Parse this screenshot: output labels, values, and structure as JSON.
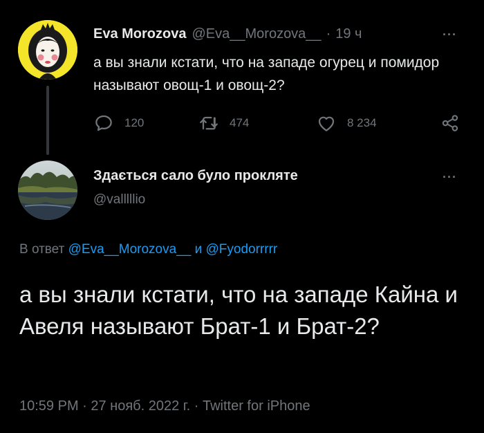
{
  "original_tweet": {
    "author_name": "Eva Morozova",
    "handle": "@Eva__Morozova__",
    "time_sep": "·",
    "time": "19 ч",
    "text": "а вы знали кстати, что на западе огурец и помидор называют овощ-1 и овощ-2?",
    "more": "···",
    "stats": {
      "replies": "120",
      "retweets": "474",
      "likes": "8 234"
    },
    "icons": {
      "reply": "reply-icon",
      "retweet": "retweet-icon",
      "like": "heart-icon",
      "share": "share-icon"
    }
  },
  "reply_tweet": {
    "author_name": "Здається сало було прокляте",
    "handle": "@valllllio",
    "more": "···",
    "reply_to_prefix": "В ответ",
    "reply_to_mention1": "@Eva__Morozova__",
    "reply_to_and": "и",
    "reply_to_mention2": "@Fyodorrrrr",
    "text": "а вы знали кстати, что на западе Кайна и Авеля называют Брат-1 и Брат-2?",
    "meta": "10:59 PM · 27 нояб. 2022 г. · Twitter for iPhone"
  },
  "colors": {
    "background": "#000000",
    "text": "#e7e9ea",
    "muted": "#71767b",
    "link": "#1d9bf0",
    "avatar_bg": "#f4e52a"
  }
}
